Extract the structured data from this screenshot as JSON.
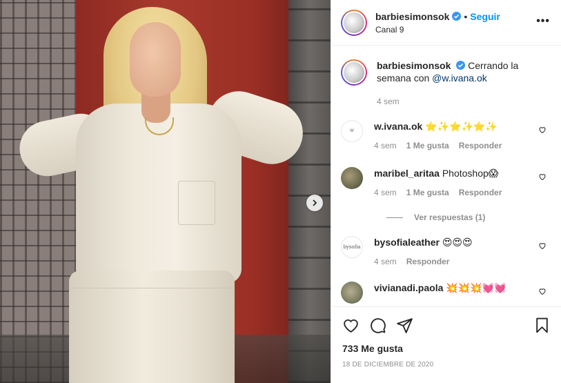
{
  "post": {
    "username": "barbiesimonsok",
    "separator": "•",
    "follow_label": "Seguir",
    "location": "Canal 9",
    "more_label": "•••"
  },
  "caption": {
    "username": "barbiesimonsok",
    "text": "Cerrando la semana con ",
    "mention": "@w.ivana.ok",
    "time": "4 sem"
  },
  "comments": [
    {
      "username": "w.ivana.ok",
      "text": "⭐✨⭐✨⭐✨",
      "time": "4 sem",
      "likes": "1 Me gusta",
      "reply": "Responder",
      "avatar_text": "W"
    },
    {
      "username": "maribel_aritaa",
      "text": "Photoshop😱",
      "time": "4 sem",
      "likes": "1 Me gusta",
      "reply": "Responder",
      "view_replies": "Ver respuestas (1)"
    },
    {
      "username": "bysofialeather",
      "text": "😍😍😍",
      "time": "4 sem",
      "reply": "Responder",
      "avatar_text": "bysofia"
    },
    {
      "username": "vivianadi.paola",
      "text": "💥💥💥💓💓"
    }
  ],
  "stats": {
    "likes": "733 Me gusta",
    "date": "18 DE DICIEMBRE DE 2020"
  },
  "colors": {
    "link": "#0095f6",
    "muted": "#8e8e8e",
    "text": "#262626",
    "verified": "#3897f0"
  }
}
